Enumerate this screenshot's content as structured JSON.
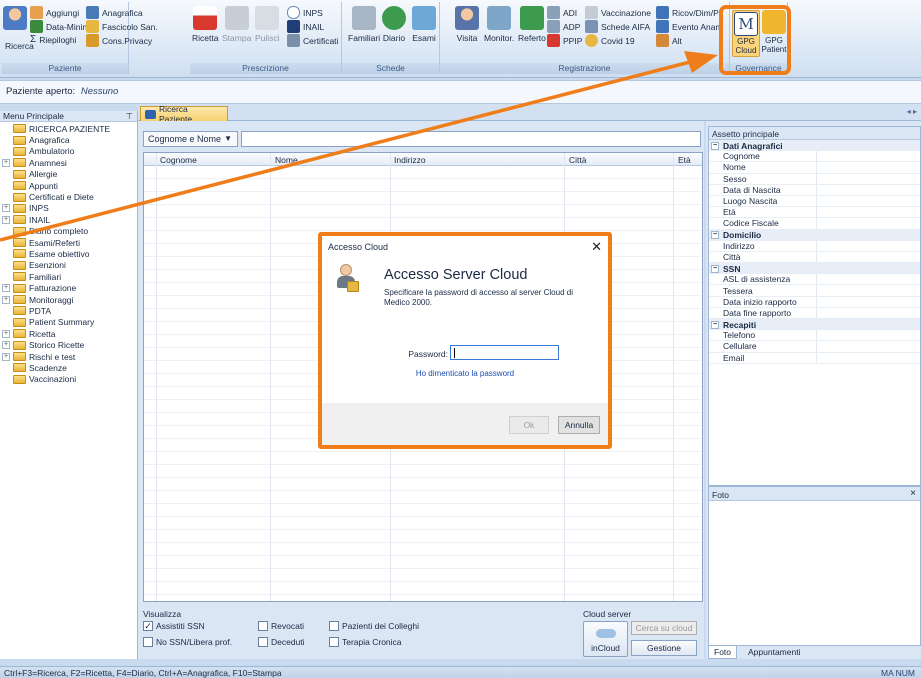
{
  "ribbon": {
    "groups": {
      "paziente": {
        "title": "Paziente",
        "ricerca": "Ricerca",
        "aggiungi": "Aggiungi",
        "data_mining": "Data-Mining",
        "riepiloghi": "Riepiloghi",
        "anagrafica": "Anagrafica",
        "fascicolo": "Fascicolo San.",
        "cons_privacy": "Cons.Privacy"
      },
      "prescrizione": {
        "title": "Prescrizione",
        "ricetta": "Ricetta",
        "stampa": "Stampa",
        "pulisci": "Pulisci",
        "inps": "INPS",
        "inail": "INAIL",
        "certificati": "Certificati"
      },
      "schede": {
        "title": "Schede",
        "familiari": "Familiari",
        "diario": "Diario",
        "esami": "Esami"
      },
      "registrazione": {
        "title": "Registrazione",
        "visita": "Visita",
        "monitor": "Monitor.",
        "referto": "Referto",
        "adi": "ADI",
        "adp": "ADP",
        "ppip": "PPIP",
        "vaccinazione": "Vaccinazione",
        "schede_aifa": "Schede AIFA",
        "covid": "Covid 19",
        "ricov": "Ricov/Dim/P",
        "evento": "Evento Anam",
        "alt": "Alt"
      },
      "governance": {
        "title": "Governance",
        "gpg_cloud": "GPG Cloud",
        "gpg_patient": "GPG Patient"
      }
    }
  },
  "patient_bar": {
    "label": "Paziente aperto:",
    "value": "Nessuno"
  },
  "left_menu": {
    "title": "Menu Principale",
    "pin": "⊤",
    "items": [
      {
        "label": "RICERCA PAZIENTE",
        "expandable": false
      },
      {
        "label": "Anagrafica",
        "expandable": false
      },
      {
        "label": "Ambulatorio",
        "expandable": false
      },
      {
        "label": "Anamnesi",
        "expandable": true
      },
      {
        "label": "Allergie",
        "expandable": false
      },
      {
        "label": "Appunti",
        "expandable": false
      },
      {
        "label": "Certificati e Diete",
        "expandable": false
      },
      {
        "label": "INPS",
        "expandable": true
      },
      {
        "label": "INAIL",
        "expandable": true
      },
      {
        "label": "Diario completo",
        "expandable": false
      },
      {
        "label": "Esami/Referti",
        "expandable": false
      },
      {
        "label": "Esame obiettivo",
        "expandable": false
      },
      {
        "label": "Esenzioni",
        "expandable": false
      },
      {
        "label": "Familiari",
        "expandable": false
      },
      {
        "label": "Fatturazione",
        "expandable": true
      },
      {
        "label": "Monitoraggi",
        "expandable": true
      },
      {
        "label": "PDTA",
        "expandable": false
      },
      {
        "label": "Patient Summary",
        "expandable": false
      },
      {
        "label": "Ricetta",
        "expandable": true
      },
      {
        "label": "Storico Ricette",
        "expandable": true
      },
      {
        "label": "Rischi e test",
        "expandable": true
      },
      {
        "label": "Scadenze",
        "expandable": false
      },
      {
        "label": "Vaccinazioni",
        "expandable": false
      }
    ]
  },
  "tab": {
    "label": "Ricerca Paziente",
    "scroll_arrows": "◂ ▸"
  },
  "search": {
    "field_select": "Cognome e Nome",
    "value": ""
  },
  "grid": {
    "columns": [
      "Cognome",
      "Nome",
      "Indirizzo",
      "Città",
      "Età"
    ]
  },
  "filters": {
    "title": "Visualizza",
    "assistiti_ssn": "Assistiti SSN",
    "no_ssn": "No SSN/Libera prof.",
    "revocati": "Revocati",
    "deceduti": "Deceduti",
    "pazienti_colleghi": "Pazienti dei Colleghi",
    "terapia_cronica": "Terapia Cronica"
  },
  "cloud_server": {
    "title": "Cloud server",
    "incloud": "inCloud",
    "cerca": "Cerca su cloud",
    "gestione": "Gestione"
  },
  "properties": {
    "title": "Assetto principale",
    "categories": [
      {
        "name": "Dati Anagrafici",
        "rows": [
          "Cognome",
          "Nome",
          "Sesso",
          "Data di Nascita",
          "Luogo Nascita",
          "Età",
          "Codice Fiscale"
        ]
      },
      {
        "name": "Domicilio",
        "rows": [
          "Indirizzo",
          "Città"
        ]
      },
      {
        "name": "SSN",
        "rows": [
          "ASL di assistenza",
          "Tessera",
          "Data inizio rapporto",
          "Data fine rapporto"
        ]
      },
      {
        "name": "Recapiti",
        "rows": [
          "Telefono",
          "Cellulare",
          "Email"
        ]
      }
    ]
  },
  "foto": {
    "title": "Foto",
    "close": "×",
    "tabs": [
      "Foto",
      "Appuntamenti"
    ]
  },
  "status": {
    "shortcuts": "Ctrl+F3=Ricerca, F2=Ricetta, F4=Diario, Ctrl+A=Anagrafica, F10=Stampa",
    "indicators": "MA  NUM"
  },
  "dialog": {
    "title": "Accesso Cloud",
    "close": "✕",
    "heading": "Accesso Server Cloud",
    "message": "Specificare la password di accesso al server Cloud di Medico 2000.",
    "password_label": "Password:",
    "password_value": "",
    "forgot_link": "Ho dimenticato la password",
    "ok": "Ok",
    "cancel": "Annulla"
  },
  "colors": {
    "accent_orange": "#ef7d1a",
    "ribbon_bg": "#dbe7f5",
    "link_blue": "#1a4db3"
  }
}
